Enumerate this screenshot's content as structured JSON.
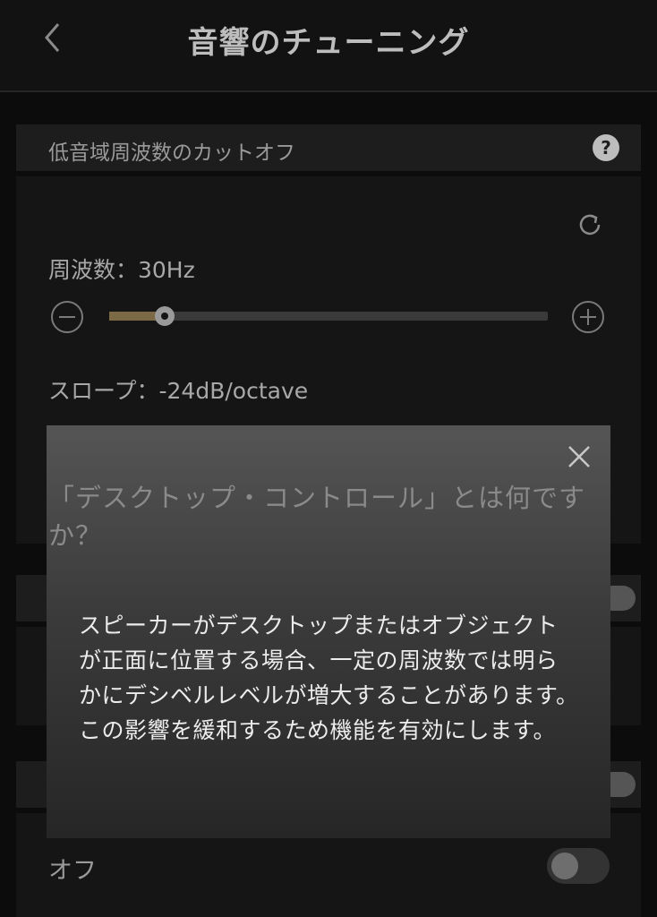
{
  "header": {
    "title": "音響のチューニング"
  },
  "section": {
    "title": "低音域周波数のカットオフ",
    "help_symbol": "?",
    "frequency_label": "周波数：30Hz",
    "slope_label": "スロープ：-24dB/octave",
    "slider": {
      "value_fraction": 0.126
    }
  },
  "off_row": {
    "label": "オフ"
  },
  "dialog": {
    "title": "「デスクトップ・コントロール」とは何ですか？",
    "body": "スピーカーがデスクトップまたはオブジェクトが正面に位置する場合、一定の周波数では明らかにデシベルレベルが増大することがあります。この影響を緩和するため機能を有効にします。"
  },
  "colors": {
    "accent": "#7b6a45",
    "background": "#0c0c0c",
    "panel": "#1d1d1d"
  },
  "icons": {
    "back": "chevron-left-icon",
    "help": "question-circle-icon",
    "reset": "refresh-icon",
    "minus": "minus-circle-icon",
    "plus": "plus-circle-icon",
    "close": "close-icon"
  }
}
